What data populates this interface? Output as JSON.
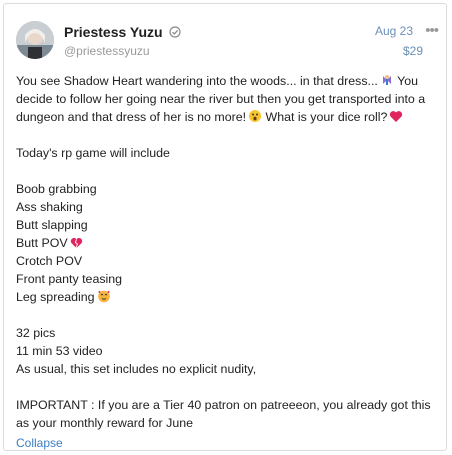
{
  "post": {
    "author_name": "Priestess Yuzu",
    "author_handle": "@priestessyuzu",
    "date": "Aug 23",
    "price": "$29",
    "more_icon": "more-horizontal-icon",
    "verified_icon": "verified-check-icon",
    "intro_line_1": "You see Shadow Heart wandering into the woods... in that dress...",
    "intro_line_2": "You decide to follow her going near the river but then you get transported into a dungeon and that dress of her is no more!",
    "intro_line_3": "What is your dice roll?",
    "game_heading": "Today's rp game will include",
    "items": [
      {
        "text": "Boob grabbing"
      },
      {
        "text": "Ass shaking"
      },
      {
        "text": "Butt slapping"
      },
      {
        "text": "Butt POV",
        "emoji": "broken-heart-icon"
      },
      {
        "text": "Crotch POV"
      },
      {
        "text": "Front panty teasing"
      },
      {
        "text": "Leg spreading",
        "emoji": "blushing-face-hearts-icon"
      }
    ],
    "stats": [
      "32 pics",
      "11 min 53 video",
      "As usual, this set includes no explicit nudity,"
    ],
    "important": "IMPORTANT : If you are a Tier 40 patron on patreeeon, you already got this as your monthly reward for June",
    "collapse_label": "Collapse"
  },
  "colors": {
    "link": "#3b7fc4",
    "meta": "#6b8fb8",
    "heart": "#e0245e"
  }
}
